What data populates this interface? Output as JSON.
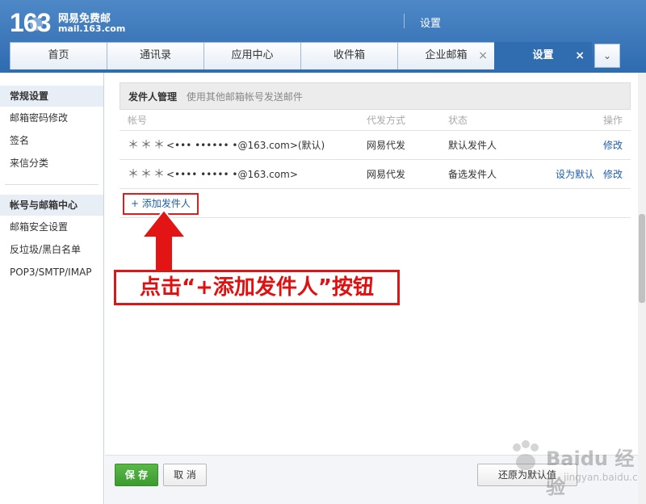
{
  "app": {
    "logo_number": "163",
    "logo_name": "网易免费邮",
    "logo_domain": "mail.163.com",
    "header_title": "设置"
  },
  "tabs": [
    {
      "label": "首页",
      "closable": false,
      "active": false
    },
    {
      "label": "通讯录",
      "closable": false,
      "active": false
    },
    {
      "label": "应用中心",
      "closable": false,
      "active": false
    },
    {
      "label": "收件箱",
      "closable": false,
      "active": false
    },
    {
      "label": "企业邮箱",
      "closable": true,
      "active": false
    },
    {
      "label": "设置",
      "closable": true,
      "active": true
    }
  ],
  "tab_close_glyph": "×",
  "tab_more_glyph": "⌄",
  "sidebar": {
    "section1_title": "常规设置",
    "section1_items": [
      "邮箱密码修改",
      "签名",
      "来信分类"
    ],
    "section2_title": "帐号与邮箱中心",
    "section2_items": [
      "邮箱安全设置",
      "反垃圾/黑白名单",
      "POP3/SMTP/IMAP"
    ]
  },
  "panel": {
    "title": "发件人管理",
    "subtitle": "使用其他邮箱帐号发送邮件",
    "col_account": "帐号",
    "col_method": "代发方式",
    "col_status": "状态",
    "col_action": "操作",
    "rows": [
      {
        "stars": "＊＊＊",
        "account": "<••• •••••• •@163.com>(默认)",
        "method": "网易代发",
        "status": "默认发件人",
        "action_modify": "修改",
        "action_default": ""
      },
      {
        "stars": "＊＊＊",
        "account": "<•••• ••••• •@163.com>",
        "method": "网易代发",
        "status": "备选发件人",
        "action_modify": "修改",
        "action_default": "设为默认"
      }
    ],
    "add_button": "+ 添加发件人"
  },
  "annotation": {
    "text": "点击“+添加发件人”按钮"
  },
  "footer": {
    "save": "保 存",
    "cancel": "取 消",
    "reset": "还原为默认值"
  },
  "watermark": {
    "text": "Baidu 经验",
    "sub": "jingyan.baidu.com"
  }
}
